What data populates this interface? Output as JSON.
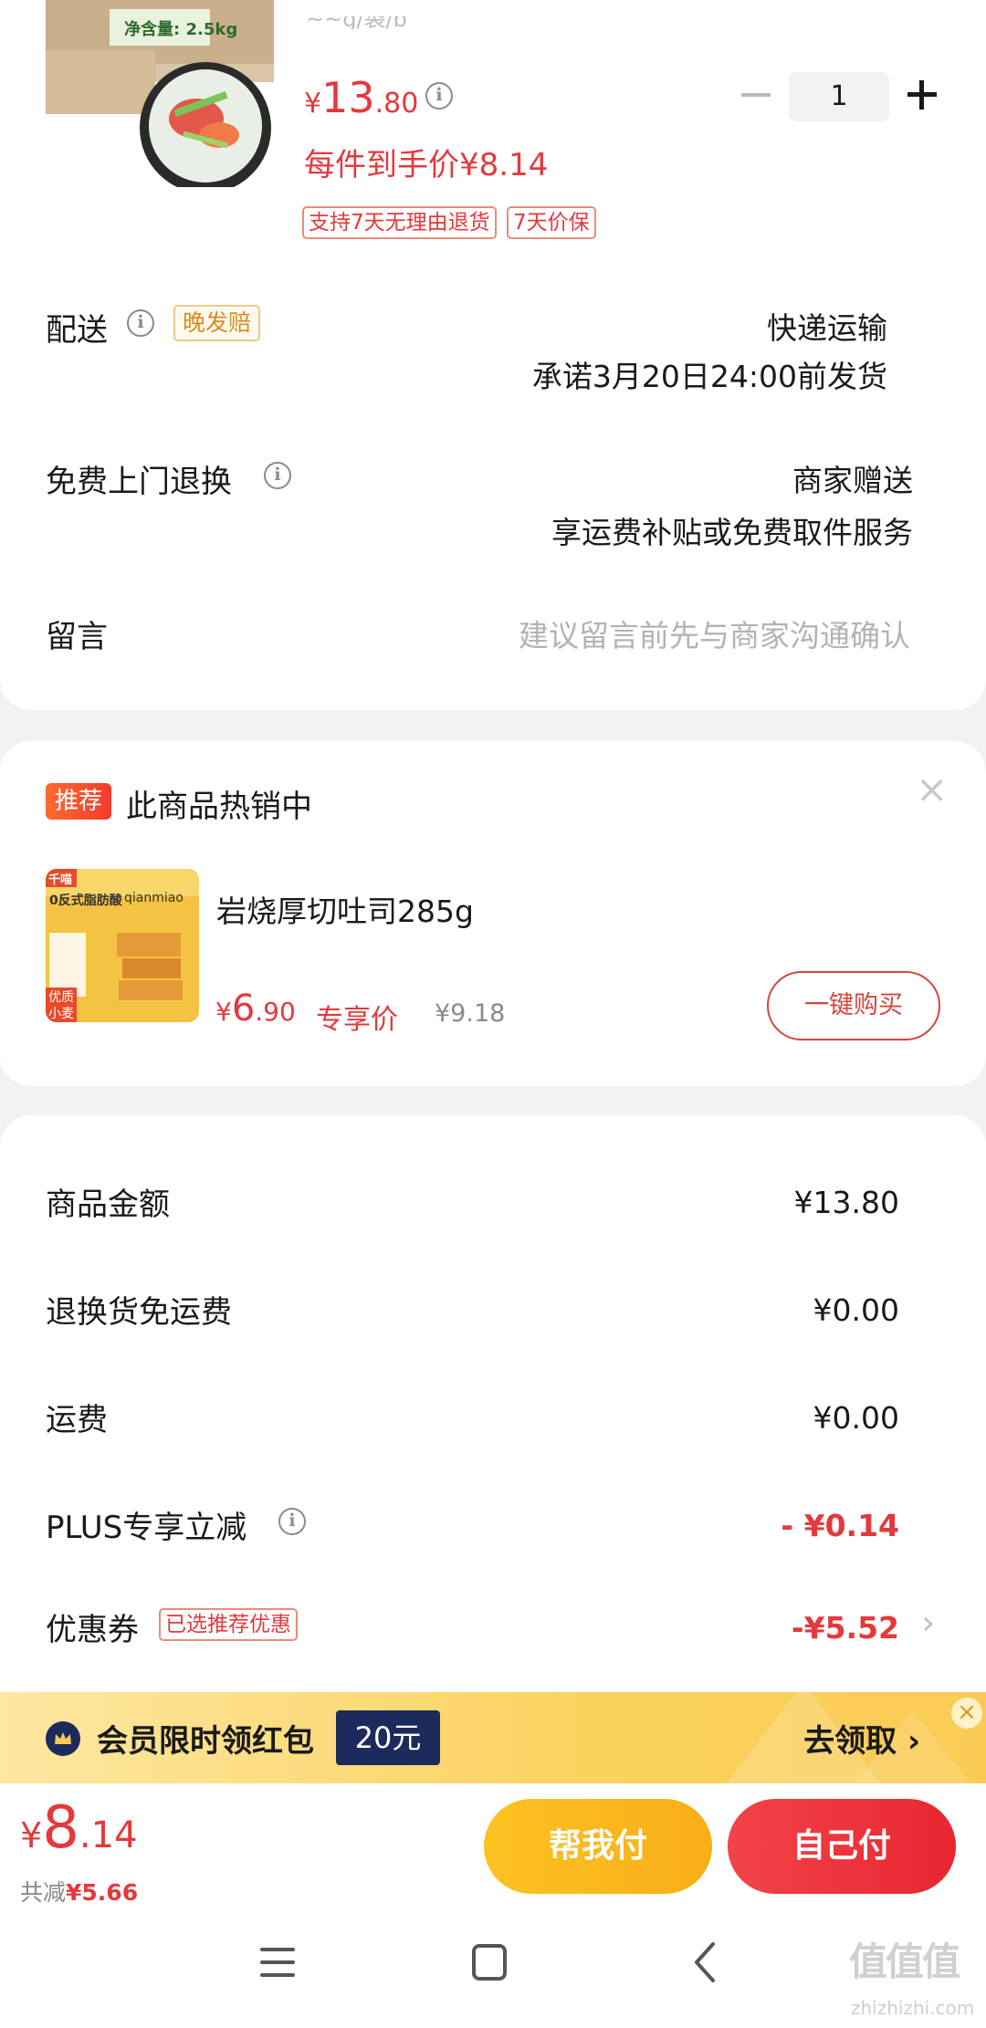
{
  "product": {
    "subtitle_fragment": "~~g/袋/b",
    "package_weight": "净含量: 2.5kg",
    "price_symbol": "¥",
    "price_int": "13",
    "price_dec": ".80",
    "unit_price": "每件到手价¥8.14",
    "quantity": "1",
    "tags": [
      "支持7天无理由退货",
      "7天价保"
    ]
  },
  "delivery": {
    "label": "配送",
    "late_tag": "晚发赔",
    "method": "快递运输",
    "promise": "承诺3月20日24:00前发货"
  },
  "return_service": {
    "label": "免费上门退换",
    "provider": "商家赠送",
    "desc": "享运费补贴或免费取件服务"
  },
  "message": {
    "label": "留言",
    "placeholder": "建议留言前先与商家沟通确认"
  },
  "recommend": {
    "badge": "推荐",
    "title": "此商品热销中",
    "close": "×",
    "name": "岩烧厚切吐司285g",
    "price_symbol": "¥",
    "price_int": "6",
    "price_dec": ".90",
    "price_tag": "专享价",
    "orig_price": "¥9.18",
    "buy_button": "一键购买",
    "img_texts": [
      "千喵",
      "0反式脂肪酸",
      "qianmiao",
      "优质",
      "小麦"
    ]
  },
  "summary": {
    "rows": [
      {
        "label": "商品金额",
        "value": "¥13.80"
      },
      {
        "label": "退换货免运费",
        "value": "¥0.00"
      },
      {
        "label": "运费",
        "value": "¥0.00"
      },
      {
        "label": "PLUS专享立减",
        "value": "- ¥0.14"
      },
      {
        "label": "优惠券",
        "value": "-¥5.52"
      }
    ],
    "coupon_tag": "已选推荐优惠"
  },
  "banner": {
    "text": "会员限时领红包",
    "amount": "20元",
    "action": "去领取 ›",
    "close": "×"
  },
  "bottom": {
    "total_symbol": "¥",
    "total_int": "8",
    "total_dec": ".14",
    "saved_label": "共减",
    "saved_value": "¥5.66",
    "help_pay": "帮我付",
    "self_pay": "自己付"
  },
  "watermark": {
    "text": "zhizhizhi.com",
    "logo": "值值值"
  },
  "colors": {
    "accent_red": "#e4393c",
    "orange": "#f9ae18",
    "banner_navy": "#1d2a5c"
  }
}
